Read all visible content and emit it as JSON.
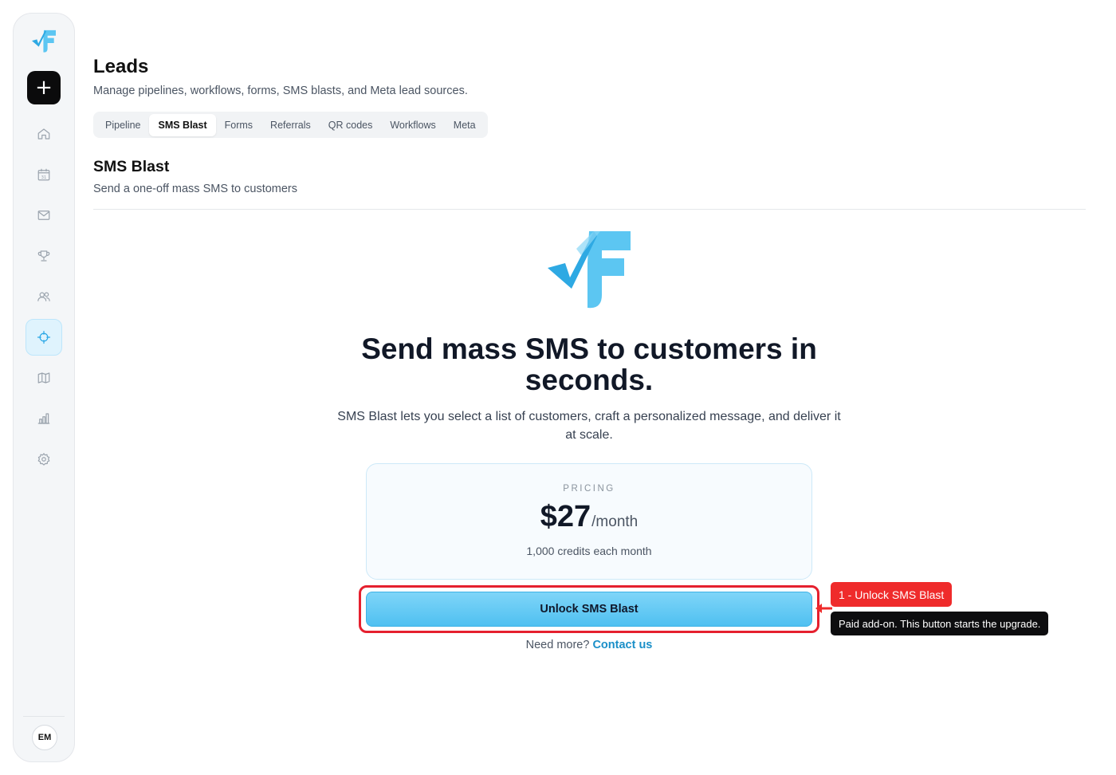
{
  "sidebar": {
    "new_label": "+",
    "nav": [
      {
        "icon": "home-icon",
        "active": false
      },
      {
        "icon": "calendar-icon",
        "active": false
      },
      {
        "icon": "mail-icon",
        "active": false
      },
      {
        "icon": "trophy-icon",
        "active": false
      },
      {
        "icon": "users-icon",
        "active": false
      },
      {
        "icon": "target-icon",
        "active": true
      },
      {
        "icon": "map-icon",
        "active": false
      },
      {
        "icon": "bar-chart-icon",
        "active": false
      },
      {
        "icon": "gear-icon",
        "active": false
      }
    ],
    "calendar_day": "31",
    "avatar_initials": "EM"
  },
  "header": {
    "title": "Leads",
    "subtitle": "Manage pipelines, workflows, forms, SMS blasts, and Meta lead sources."
  },
  "tabs": [
    {
      "label": "Pipeline"
    },
    {
      "label": "SMS Blast"
    },
    {
      "label": "Forms"
    },
    {
      "label": "Referrals"
    },
    {
      "label": "QR codes"
    },
    {
      "label": "Workflows"
    },
    {
      "label": "Meta"
    }
  ],
  "active_tab": "SMS Blast",
  "section": {
    "title": "SMS Blast",
    "subtitle": "Send a one-off mass SMS to customers"
  },
  "hero": {
    "title": "Send mass SMS to customers in seconds.",
    "description": "SMS Blast lets you select a list of customers, craft a personalized message, and deliver it at scale."
  },
  "pricing": {
    "label": "PRICING",
    "price": "$27",
    "unit": "/month",
    "credits": "1,000 credits each month"
  },
  "cta": {
    "unlock_label": "Unlock SMS Blast",
    "need_more": "Need more?",
    "contact_label": "Contact us"
  },
  "annotation": {
    "tag": "1 - Unlock SMS Blast",
    "tooltip": "Paid add-on. This button starts the upgrade."
  },
  "colors": {
    "accent": "#4fc0f1",
    "highlight": "#e5202e",
    "link": "#1a8fc8"
  }
}
